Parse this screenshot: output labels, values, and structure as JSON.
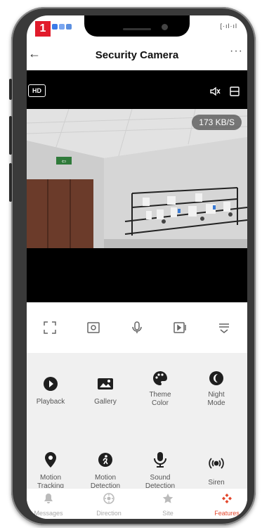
{
  "header": {
    "title": "Security Camera",
    "back_glyph": "←",
    "more_glyph": "···"
  },
  "status": {
    "logo_text": "1",
    "right_text": "[·ıl·ıl"
  },
  "video": {
    "quality_label": "HD",
    "speed": "173 KB/S",
    "exit_sign_text": "⇦"
  },
  "controls": [
    {
      "name": "fullscreen-icon"
    },
    {
      "name": "screenshot-icon"
    },
    {
      "name": "microphone-icon"
    },
    {
      "name": "record-icon"
    },
    {
      "name": "menu-collapse-icon"
    }
  ],
  "features": [
    {
      "icon": "playback-icon",
      "label": "Playback"
    },
    {
      "icon": "gallery-icon",
      "label": "Gallery"
    },
    {
      "icon": "palette-icon",
      "label": "Theme Color"
    },
    {
      "icon": "night-mode-icon",
      "label": "Night Mode"
    },
    {
      "icon": "location-pin-icon",
      "label": "Motion Tracking"
    },
    {
      "icon": "walking-person-icon",
      "label": "Motion Detection"
    },
    {
      "icon": "microphone-icon",
      "label": "Sound Detection"
    },
    {
      "icon": "siren-icon",
      "label": "Siren"
    }
  ],
  "nav": [
    {
      "icon": "bell-icon",
      "label": "Messages"
    },
    {
      "icon": "direction-icon",
      "label": "Direction"
    },
    {
      "icon": "star-icon",
      "label": "Site"
    },
    {
      "icon": "features-icon",
      "label": "Features",
      "active": true
    }
  ],
  "colors": {
    "accent": "#e3452b",
    "brand": "#e11b2b"
  }
}
